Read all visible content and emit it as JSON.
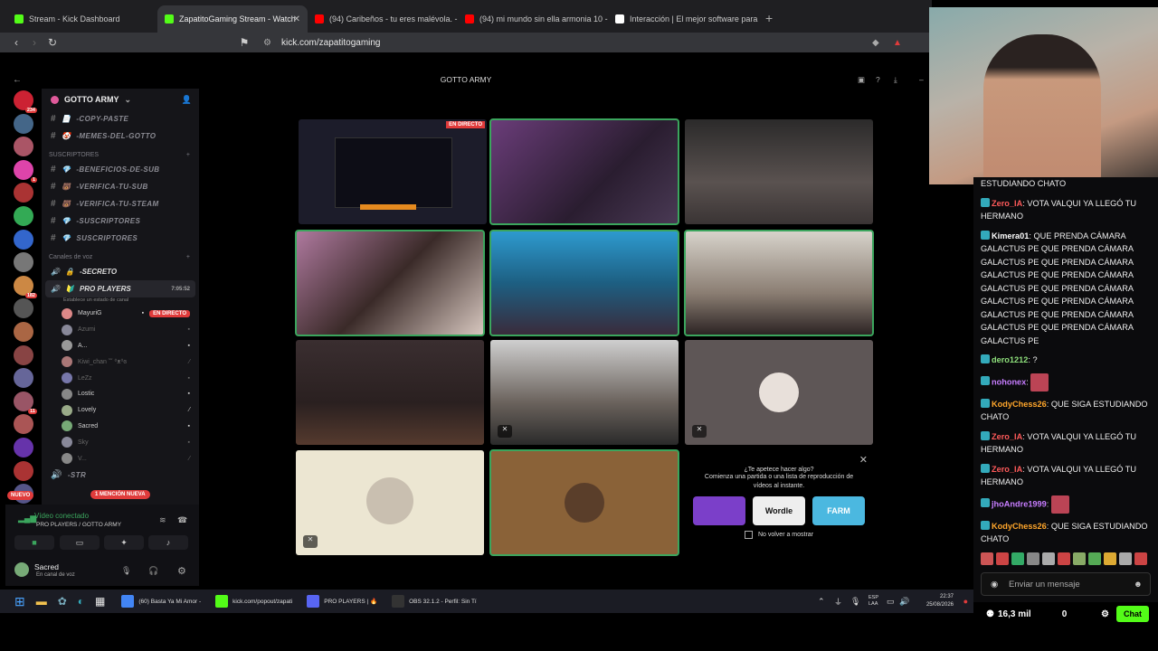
{
  "browser": {
    "tabs": [
      {
        "title": "Stream - Kick Dashboard",
        "icon": "kick-icon",
        "color": "#53fc18",
        "active": false
      },
      {
        "title": "ZapatitoGaming Stream - Watch",
        "icon": "kick-icon",
        "color": "#53fc18",
        "active": true
      },
      {
        "title": "(94) Caribeños - tu eres malévola. -",
        "icon": "youtube-icon",
        "color": "#ff0000",
        "active": false
      },
      {
        "title": "(94) mi mundo sin ella armonia 10 -",
        "icon": "youtube-icon",
        "color": "#ff0000",
        "active": false
      },
      {
        "title": "Interacción | El mejor software para",
        "icon": "app-icon",
        "color": "#ffffff",
        "active": false
      }
    ],
    "url": "kick.com/zapatitogaming"
  },
  "discord": {
    "window_title": "GOTTO ARMY",
    "server_name": "GOTTO ARMY",
    "text_channels_top": [
      {
        "name": "-COPY-PASTE",
        "emoji": "📄"
      },
      {
        "name": "-MEMES-DEL-GOTTO",
        "emoji": "🤡"
      }
    ],
    "categories": {
      "subs": "SUSCRIPTORES",
      "voice": "Canales de voz"
    },
    "sub_channels": [
      {
        "name": "-BENEFICIOS-DE-SUB",
        "emoji": "💎"
      },
      {
        "name": "-VERIFICA-TU-SUB",
        "emoji": "🐻"
      },
      {
        "name": "-VERIFICA-TU-STEAM",
        "emoji": "🐻"
      },
      {
        "name": "-SUSCRIPTORES",
        "emoji": "💎"
      },
      {
        "name": "SUSCRIPTORES",
        "emoji": "💎"
      }
    ],
    "voice_channels": [
      {
        "name": "-SECRETO",
        "emoji": "🔒"
      },
      {
        "name": "PRO PLAYERS",
        "emoji": "🔰",
        "timer": "7:05:52",
        "note": "Establece un estado de canal"
      }
    ],
    "voice_users": [
      {
        "name": "MayuriG",
        "live": "EN DIRECTO",
        "dim": false,
        "color": "#d88"
      },
      {
        "name": "Azumi",
        "dim": true,
        "color": "#889"
      },
      {
        "name": "A...",
        "dim": false,
        "color": "#999"
      },
      {
        "name": "Kiwi_chan ˜˘ ⁰ᴥ⁰ɞ",
        "dim": true,
        "color": "#a77"
      },
      {
        "name": "LeZz",
        "dim": true,
        "color": "#77a"
      },
      {
        "name": "Lostic",
        "dim": false,
        "color": "#888"
      },
      {
        "name": "Lovely",
        "dim": false,
        "color": "#9a8"
      },
      {
        "name": "Sacred",
        "dim": false,
        "color": "#7a7"
      },
      {
        "name": "Sky",
        "dim": true,
        "color": "#889"
      },
      {
        "name": "V...",
        "dim": true,
        "color": "#888"
      }
    ],
    "last_channel": "-STR",
    "mention_badge": "1 MENCIÓN NUEVA",
    "new_badge": "NUEVO",
    "server_badges": [
      "234",
      "",
      "",
      "1",
      "",
      "",
      "",
      "",
      "182",
      "",
      "",
      "",
      "",
      "11",
      "",
      "",
      "",
      "",
      "",
      "202",
      ""
    ],
    "voice_panel": {
      "status": "Vídeo conectado",
      "channel": "PRO PLAYERS / GOTTO ARMY",
      "user": "Sacred",
      "user_status": "En canal de voz"
    },
    "stage": {
      "live_label": "EN DIRECTO",
      "promo_line1": "¿Te apetece hacer algo?",
      "promo_line2": "Comienza una partida o una lista de reproducción de vídeos al instante.",
      "promo_checkbox": "No volver a mostrar",
      "promo_games": [
        "",
        "Wordle",
        "FARM"
      ]
    }
  },
  "chat": {
    "messages": [
      {
        "user": "",
        "color": "#ffffff",
        "text": "ESTUDIANDO CHATO",
        "cont": true
      },
      {
        "user": "Zero_IA",
        "color": "#ff5a5a",
        "text": "VOTA VALQUI YA LLEGÓ TU HERMANO"
      },
      {
        "user": "Kimera01",
        "color": "#ffffff",
        "text": "QUE PRENDA CÁMARA GALACTUS PE QUE PRENDA CÁMARA GALACTUS PE QUE PRENDA CÁMARA GALACTUS PE QUE PRENDA CÁMARA GALACTUS PE QUE PRENDA CÁMARA GALACTUS PE QUE PRENDA CÁMARA GALACTUS PE QUE PRENDA CÁMARA GALACTUS PE QUE PRENDA CÁMARA GALACTUS PE"
      },
      {
        "user": "dero1212",
        "color": "#8ee07c",
        "text": "?"
      },
      {
        "user": "nohonex",
        "color": "#c77dff",
        "text": "",
        "emote": true
      },
      {
        "user": "KodyChess26",
        "color": "#ffa62b",
        "text": "QUE SIGA ESTUDIANDO CHATO"
      },
      {
        "user": "Zero_IA",
        "color": "#ff5a5a",
        "text": "VOTA VALQUI YA LLEGÓ TU HERMANO"
      },
      {
        "user": "Zero_IA",
        "color": "#ff5a5a",
        "text": "VOTA VALQUI YA LLEGÓ TU HERMANO"
      },
      {
        "user": "jhoAndre1999",
        "color": "#c77dff",
        "text": "",
        "emote": true
      },
      {
        "user": "KodyChess26",
        "color": "#ffa62b",
        "text": "QUE SIGA ESTUDIANDO CHATO"
      }
    ],
    "input_placeholder": "Enviar un mensaje",
    "viewers": "16,3 mil",
    "points": "0",
    "chat_button": "Chat"
  },
  "taskbar": {
    "apps": [
      {
        "label": "(60) Basta Ya Mi Amor -",
        "color": "#4285f4"
      },
      {
        "label": "kick.com/popout/zapati",
        "color": "#53fc18"
      },
      {
        "label": "PRO PLAYERS | 🔥",
        "color": "#5865f2"
      },
      {
        "label": "OBS 32.1.2 - Perfil: Sin Tí",
        "color": "#333"
      }
    ],
    "lang": "ESP\nLAA",
    "time": "22:37",
    "date": "25/08/2026"
  }
}
